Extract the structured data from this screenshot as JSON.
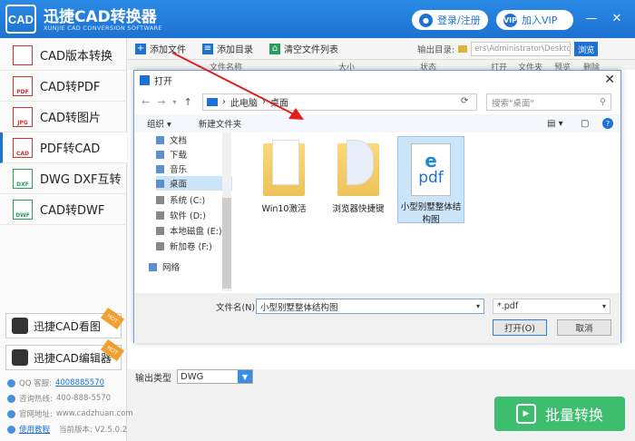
{
  "app": {
    "title": "迅捷CAD转换器",
    "subtitle": "XUNJIE CAD CONVERSION SOFTWARE",
    "logo_text": "CAD",
    "login_label": "登录/注册",
    "vip_label": "加入VIP",
    "vip_badge": "VIP"
  },
  "sidebar": {
    "items": [
      {
        "label": "CAD版本转换",
        "icon": "cad-version-icon"
      },
      {
        "label": "CAD转PDF",
        "icon": "pdf-icon"
      },
      {
        "label": "CAD转图片",
        "icon": "image-icon"
      },
      {
        "label": "PDF转CAD",
        "icon": "pdf-to-cad-icon"
      },
      {
        "label": "DWG DXF互转",
        "icon": "dwg-icon"
      },
      {
        "label": "CAD转DWF",
        "icon": "dwf-icon"
      }
    ],
    "promos": [
      {
        "label": "迅捷CAD看图",
        "badge": "HOT"
      },
      {
        "label": "迅捷CAD编辑器",
        "badge": "HOT"
      }
    ],
    "info": [
      {
        "label": "QQ 客服:",
        "value": "4008885570",
        "link": true
      },
      {
        "label": "咨询热线:",
        "value": "400-888-5570",
        "link": false
      },
      {
        "label": "官网地址:",
        "value": "www.cadzhuan.com",
        "link": false
      },
      {
        "label": "",
        "value": "使用教程",
        "link": true,
        "extra": "当前版本: V2.5.0.2"
      }
    ]
  },
  "toolbar": {
    "add_file": "添加文件",
    "add_dir": "添加目录",
    "clear": "清空文件列表",
    "output_dir_label": "输出目录:",
    "output_path": "ers\\Administrator\\Desktop",
    "browse": "浏览"
  },
  "columns": [
    "文件名称",
    "大小",
    "状态",
    "打开",
    "文件夹",
    "预览",
    "删除"
  ],
  "dialog": {
    "title": "打开",
    "breadcrumb": [
      "此电脑",
      "桌面"
    ],
    "search_placeholder": "搜索\"桌面\"",
    "organize": "组织 ▾",
    "new_folder": "新建文件夹",
    "tree": [
      {
        "label": "文档"
      },
      {
        "label": "下载"
      },
      {
        "label": "音乐"
      },
      {
        "label": "桌面",
        "selected": true
      },
      {
        "label": "系统 (C:)"
      },
      {
        "label": "软件 (D:)"
      },
      {
        "label": "本地磁盘 (E:)"
      },
      {
        "label": "新加卷 (F:)"
      },
      {
        "label": "网络"
      }
    ],
    "files": [
      {
        "name": "Win10激活",
        "type": "folder"
      },
      {
        "name": "浏览器快捷键",
        "type": "folder"
      },
      {
        "name": "小型别墅整体结构图",
        "type": "pdf",
        "selected": true
      }
    ],
    "filename_label": "文件名(N):",
    "filename_value": "小型别墅整体结构图",
    "filetype_value": "*.pdf",
    "open_label": "打开(O)",
    "cancel_label": "取消"
  },
  "output": {
    "type_label": "输出类型",
    "type_value": "DWG"
  },
  "batch_label": "批量转换",
  "colors": {
    "brand": "#1d72d1",
    "green": "#3dbd6e",
    "arrow": "#e02020"
  }
}
